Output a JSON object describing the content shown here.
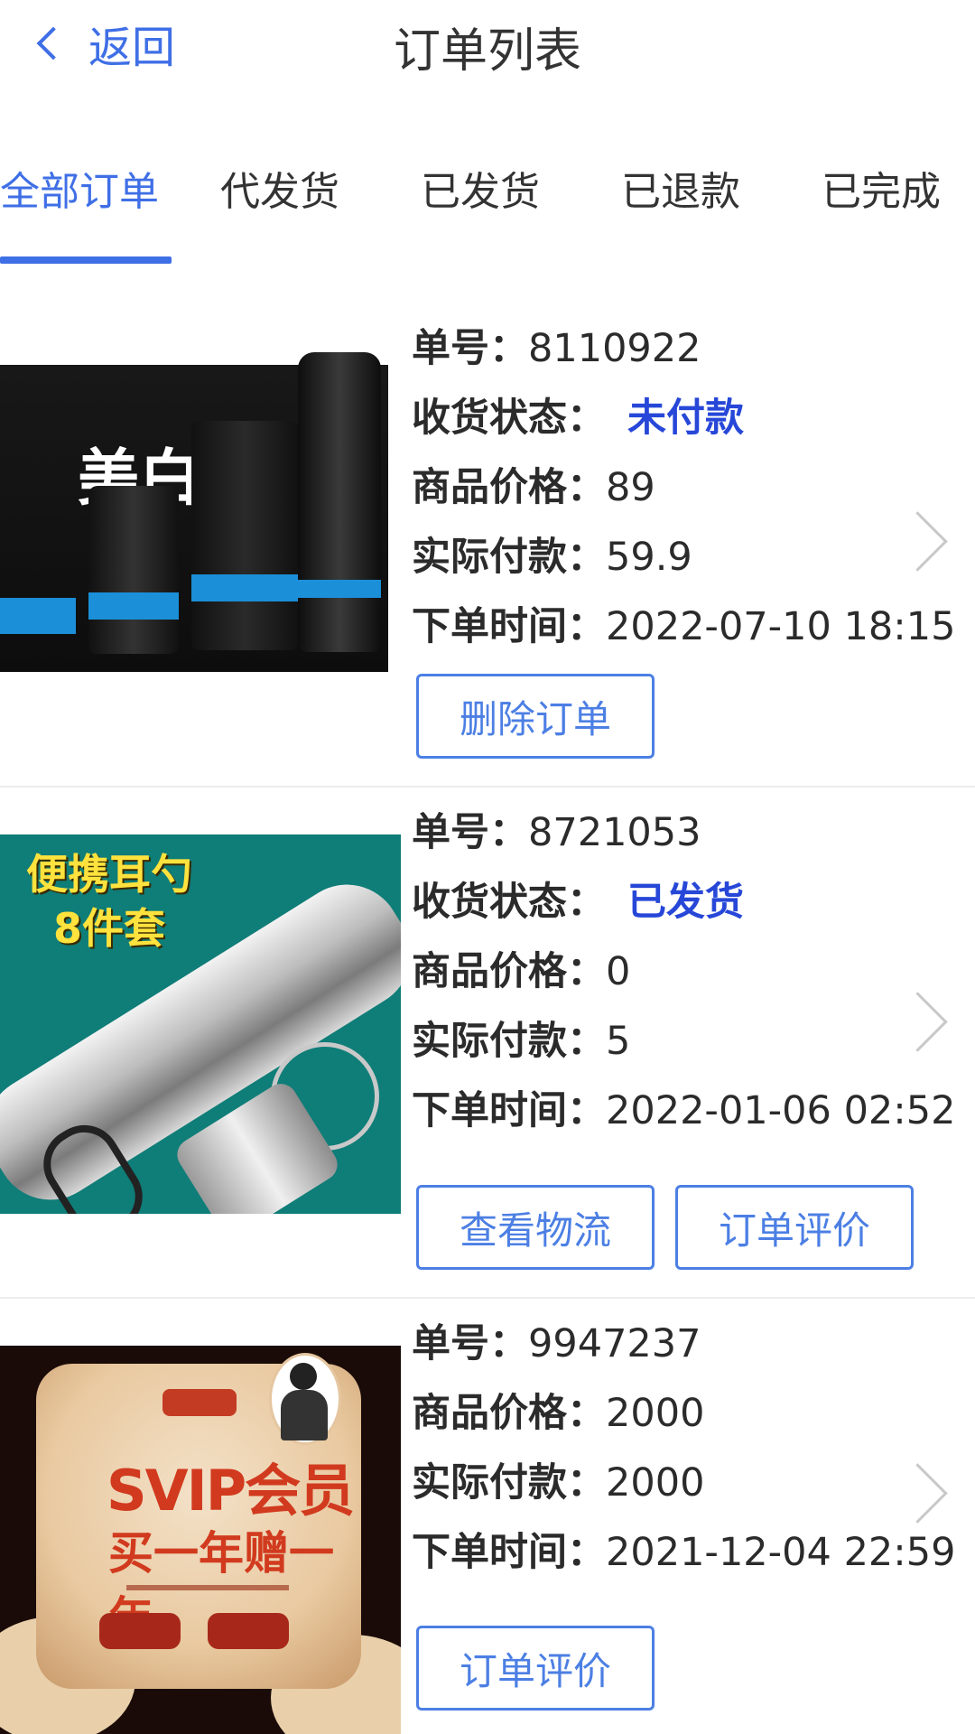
{
  "header": {
    "back_label": "返回",
    "title": "订单列表"
  },
  "tabs": [
    {
      "label": "全部订单",
      "active": true
    },
    {
      "label": "代发货",
      "active": false
    },
    {
      "label": "已发货",
      "active": false
    },
    {
      "label": "已退款",
      "active": false
    },
    {
      "label": "已完成",
      "active": false
    }
  ],
  "labels": {
    "order_no": "单号：",
    "status": "收货状态：",
    "price": "商品价格：",
    "paid": "实际付款：",
    "time": "下单时间："
  },
  "orders": [
    {
      "order_no": "8110922",
      "status": "未付款",
      "price": "89",
      "paid": "59.9",
      "time": "2022-07-10 18:15",
      "image_text": "美白",
      "buttons": [
        "删除订单"
      ]
    },
    {
      "order_no": "8721053",
      "status": "已发货",
      "price": "0",
      "paid": "5",
      "time": "2022-01-06 02:52",
      "image_text": "便携耳勺\n8件套",
      "buttons": [
        "查看物流",
        "订单评价"
      ]
    },
    {
      "order_no": "9947237",
      "price": "2000",
      "paid": "2000",
      "time": "2021-12-04 22:59",
      "image_text": "SVIP会员",
      "image_subtext": "买一年赠一年",
      "buttons": [
        "订单评价"
      ]
    }
  ],
  "colors": {
    "accent": "#3f6fe6",
    "status": "#2747d8",
    "button_border": "#4c7fe4",
    "divider": "#ececec"
  }
}
